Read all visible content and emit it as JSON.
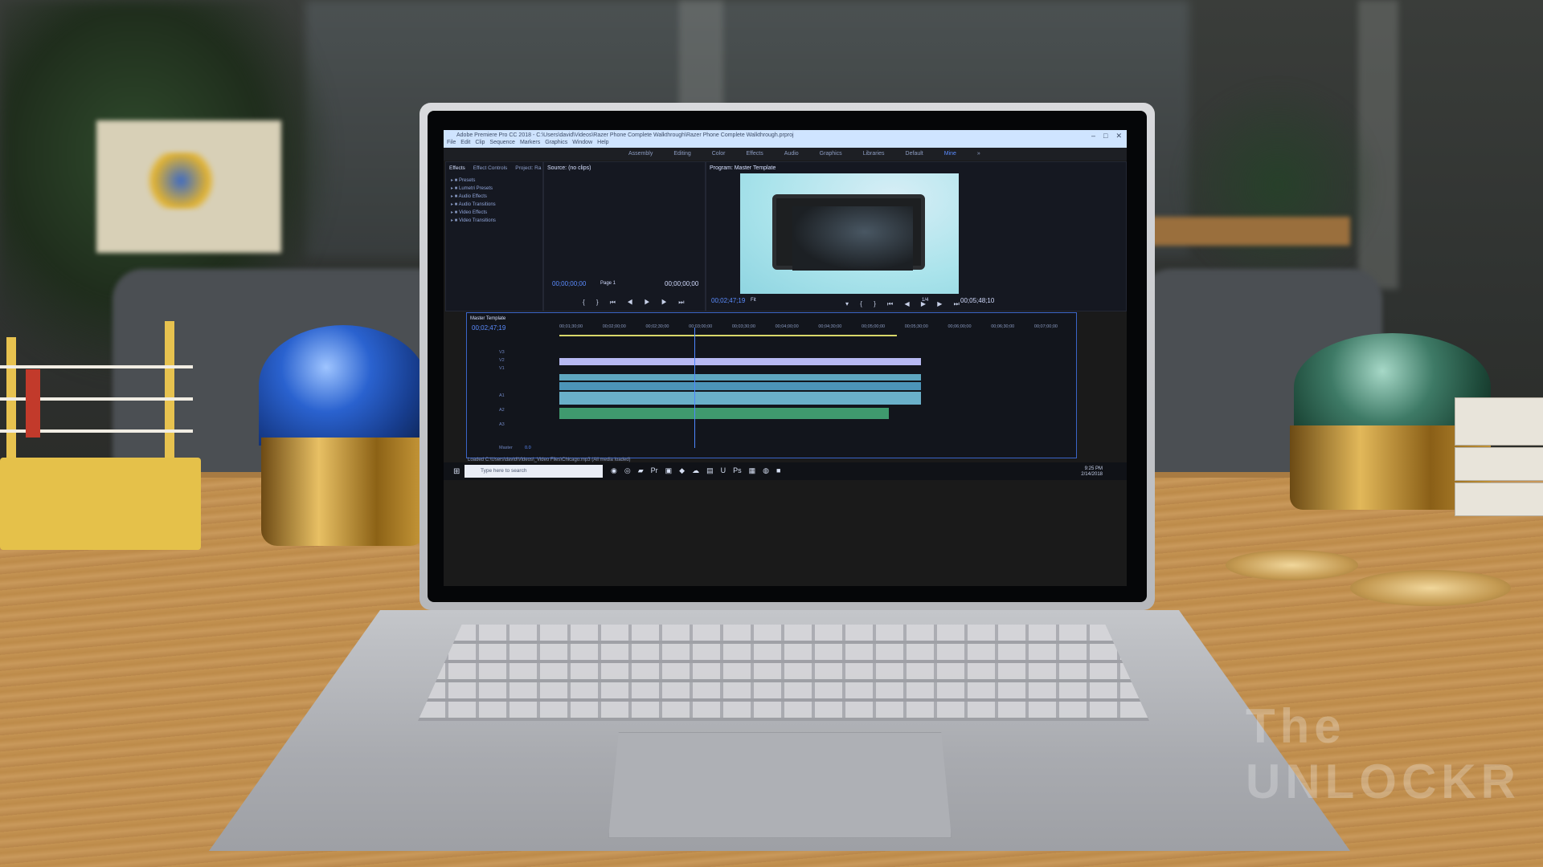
{
  "window": {
    "title": "Adobe Premiere Pro CC 2018 - C:\\Users\\david\\Videos\\Razer Phone Complete Walkthrough\\Razer Phone Complete Walkthrough.prproj",
    "menu": [
      "File",
      "Edit",
      "Clip",
      "Sequence",
      "Markers",
      "Graphics",
      "Window",
      "Help"
    ]
  },
  "workspaces": [
    "Assembly",
    "Editing",
    "Color",
    "Effects",
    "Audio",
    "Graphics",
    "Libraries",
    "Default",
    "Mine"
  ],
  "active_workspace": "Mine",
  "effects_panel": {
    "tabs": [
      "Effects",
      "Effect Controls",
      "Project: Ra"
    ],
    "items": [
      "Presets",
      "Lumetri Presets",
      "Audio Effects",
      "Audio Transitions",
      "Video Effects",
      "Video Transitions"
    ]
  },
  "source_monitor": {
    "label": "Source: (no clips)",
    "timecode_in": "00;00;00;00",
    "timecode_out": "00;00;00;00",
    "page": "Page 1"
  },
  "program_monitor": {
    "label": "Program: Master Template",
    "timecode": "00;02;47;19",
    "fit": "Fit",
    "resolution": "1/4",
    "duration": "00;05;48;10"
  },
  "timeline": {
    "sequence": "Master Template",
    "timecode": "00;02;47;19",
    "ruler": [
      "00;01;30;00",
      "00;02;00;00",
      "00;02;30;00",
      "00;03;00;00",
      "00;03;30;00",
      "00;04;00;00",
      "00;04;30;00",
      "00;05;00;00",
      "00;05;30;00",
      "00;06;00;00",
      "00;06;30;00",
      "00;07;00;00"
    ],
    "tracks": [
      "V3",
      "V2",
      "V1",
      "A1",
      "A2",
      "A3"
    ],
    "master": "Master",
    "master_value": "0.0"
  },
  "status_text": "Loaded C:\\Users\\david\\Videos\\_Video Files\\Chicago.mp3 (All media loaded)",
  "taskbar": {
    "search_placeholder": "Type here to search",
    "time": "9:25 PM",
    "date": "2/14/2018"
  },
  "watermark": "The UNLOCKR",
  "colors": {
    "accent": "#5b8cff",
    "video_clip": "#6ab0c9",
    "audio_clip": "#3f9a6e",
    "graphic_clip": "#b7b9f2"
  }
}
